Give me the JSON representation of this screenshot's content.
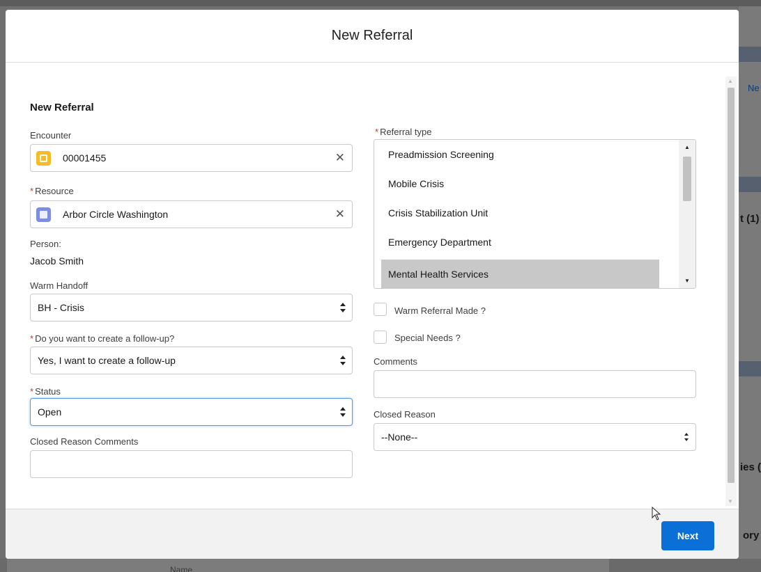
{
  "modal": {
    "title": "New Referral",
    "section_title": "New Referral",
    "next_label": "Next"
  },
  "encounter": {
    "label": "Encounter",
    "value": "00001455",
    "clear": "✕"
  },
  "resource": {
    "required": "*",
    "label": "Resource",
    "value": "Arbor Circle Washington",
    "clear": "✕"
  },
  "person": {
    "label": "Person:",
    "value": "Jacob Smith"
  },
  "warm_handoff": {
    "label": "Warm Handoff",
    "value": "BH - Crisis"
  },
  "follow_up": {
    "required": "*",
    "label": "Do you want to create a follow-up?",
    "value": "Yes, I want to create a follow-up"
  },
  "status": {
    "required": "*",
    "label": "Status",
    "value": "Open"
  },
  "closed_reason_comments": {
    "label": "Closed Reason Comments",
    "value": ""
  },
  "referral_type": {
    "required": "*",
    "label": "Referral type",
    "options": [
      "Preadmission Screening",
      "Mobile Crisis",
      "Crisis Stabilization Unit",
      "Emergency Department",
      "Mental Health Services"
    ],
    "selected": "Mental Health Services"
  },
  "warm_referral": {
    "label": "Warm Referral Made ?",
    "checked": false
  },
  "special_needs": {
    "label": "Special Needs ?",
    "checked": false
  },
  "comments": {
    "label": "Comments",
    "value": ""
  },
  "closed_reason": {
    "label": "Closed Reason",
    "value": "--None--"
  },
  "background": {
    "frag_ne": "Ne",
    "frag_t1": "t (1)",
    "frag_ies": "ies (",
    "frag_ory": "ory",
    "name_label": "Name"
  }
}
